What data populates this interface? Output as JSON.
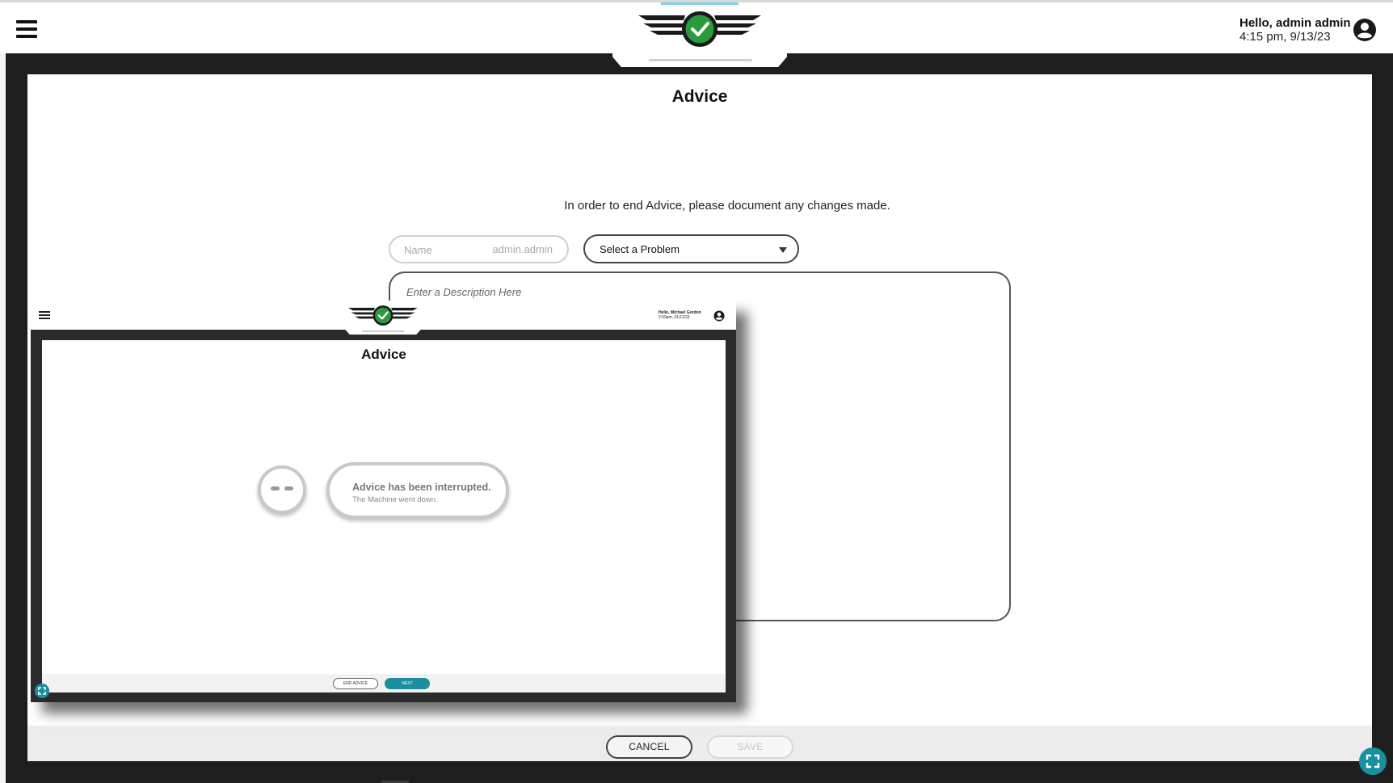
{
  "header": {
    "greeting": "Hello, admin admin",
    "datetime": "4:15 pm, 9/13/23"
  },
  "page": {
    "title": "Advice",
    "instruction": "In order to end Advice, please document any changes made.",
    "name_label": "Name",
    "name_value": "admin.admin",
    "problem_select": "Select a Problem",
    "description_placeholder": "Enter a Description Here"
  },
  "footer": {
    "cancel_label": "CANCEL",
    "save_label": "SAVE"
  },
  "embedded_screenshot": {
    "greeting": "Hello, Michael Gordon",
    "datetime": "2:59pm, 01/11/23",
    "title": "Advice",
    "status_title": "Advice has been interrupted.",
    "status_detail": "The Machine went down.",
    "end_advice_label": "END ADVICE",
    "next_label": "NEXT"
  },
  "colors": {
    "accent_teal": "#198f9f",
    "logo_green": "#2a9a3c",
    "dark_frame": "#1e1e1e"
  }
}
